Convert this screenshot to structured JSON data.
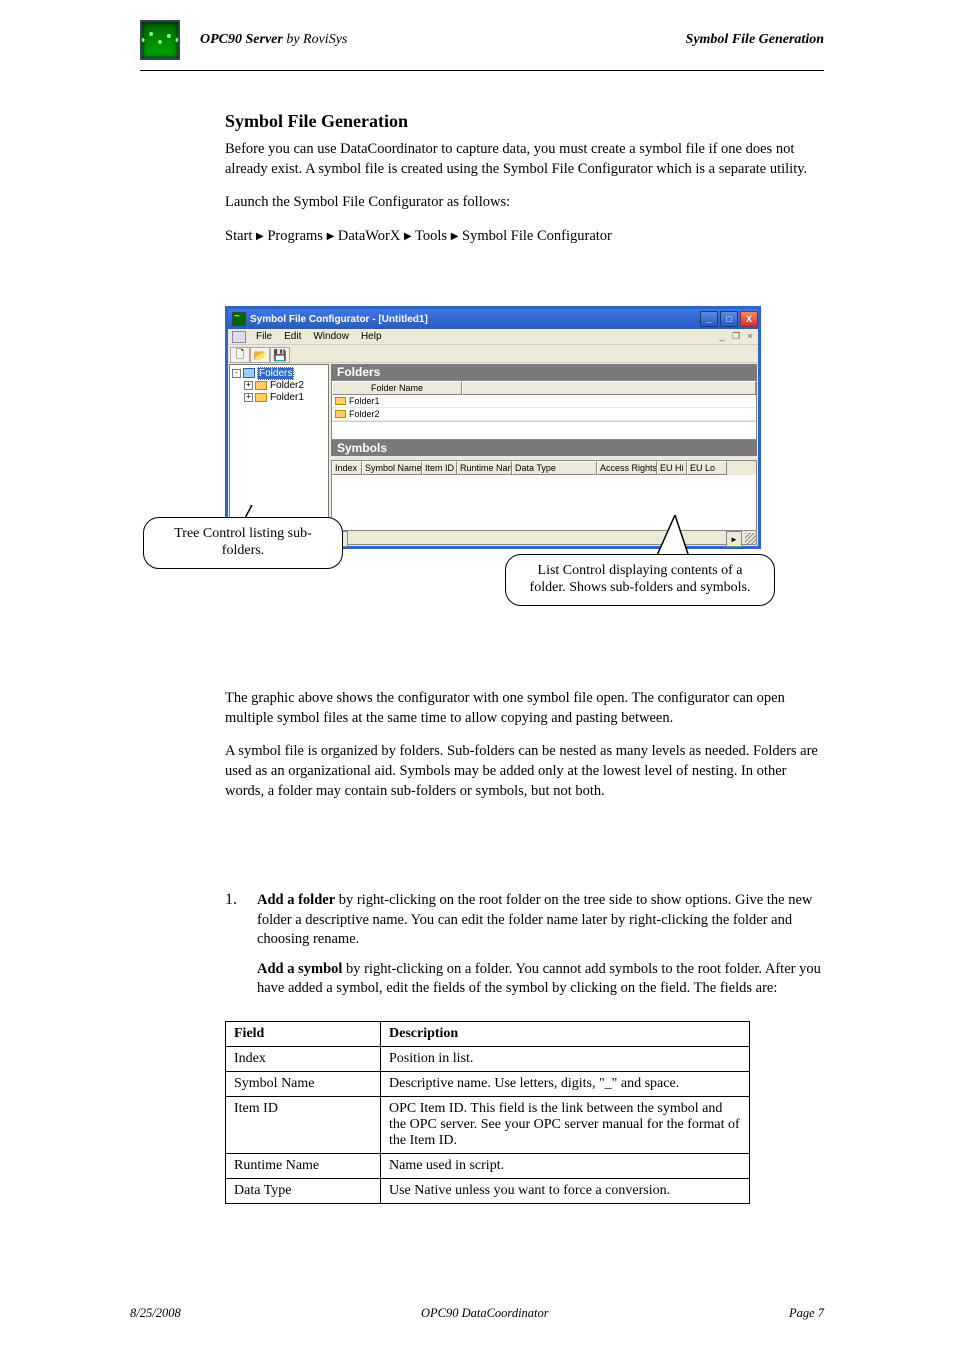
{
  "header": {
    "product": "OPC90 Server",
    "subtitle": "by RoviSys",
    "page_title": "Symbol File Generation"
  },
  "intro_paragraphs": [
    "Before you can use DataCoordinator to capture data, you must create a symbol file if one does not already exist. A symbol file is created using the Symbol File Configurator which is a separate utility."
  ],
  "launch_path": [
    "Start",
    "Programs",
    "DataWorX",
    "Tools",
    "Symbol File Configurator"
  ],
  "launch_instruction": "Launch the Symbol File Configurator as follows:",
  "screenshot": {
    "title": "Symbol File Configurator  - [Untitled1]",
    "menus": [
      "File",
      "Edit",
      "Window",
      "Help"
    ],
    "tree": {
      "root": "Folders",
      "children": [
        "Folder2",
        "Folder1"
      ]
    },
    "folders_header": "Folders",
    "folders_col": "Folder Name",
    "folders_rows": [
      "Folder1",
      "Folder2"
    ],
    "symbols_header": "Symbols",
    "symbol_cols": [
      "Index",
      "Symbol Name",
      "Item ID",
      "Runtime Name",
      "Data Type",
      "Access Rights",
      "EU Hi",
      "EU Lo"
    ]
  },
  "callout_left": "Tree Control listing sub-folders.",
  "callout_right": "List Control displaying contents of a folder.  Shows sub-folders and symbols.",
  "after_screenshot": [
    "The graphic above shows the configurator with one symbol file open.  The configurator can open multiple symbol files at the same time to allow copying and pasting between.",
    "A symbol file is organized by folders.  Sub-folders can be nested as many levels as needed.  Folders are used as an organizational aid.  Symbols may be added only at the lowest level of nesting.  In other words, a folder may contain sub-folders or symbols, but not both."
  ],
  "step": {
    "num": "1.",
    "title_bold": "Add a folder",
    "remainder": " by right-clicking on the root folder on the tree side to show options.  Give the new folder a descriptive name.  You can edit the folder name later by right-clicking the folder and choosing rename.",
    "add_symbol_bold": "Add a symbol",
    "add_symbol_remainder": " by right-clicking on a folder.  You cannot add symbols to the root folder.  After you have added a symbol, edit the fields of the symbol by clicking on the field.  The fields are:"
  },
  "fields_table": {
    "head": [
      "Field",
      "Description"
    ],
    "rows": [
      [
        "Index",
        "Position in list."
      ],
      [
        "Symbol Name",
        "Descriptive name.  Use letters, digits, \"_\" and space."
      ],
      [
        "Item ID",
        "OPC Item ID.  This field is the link between the symbol and the OPC server.  See your OPC server manual for the format of the Item ID."
      ],
      [
        "Runtime Name",
        "Name used in script."
      ],
      [
        "Data Type",
        "Use Native unless you want to force a conversion."
      ]
    ]
  },
  "footer": {
    "date": "8/25/2008",
    "center": "OPC90 DataCoordinator",
    "page": "Page 7"
  }
}
